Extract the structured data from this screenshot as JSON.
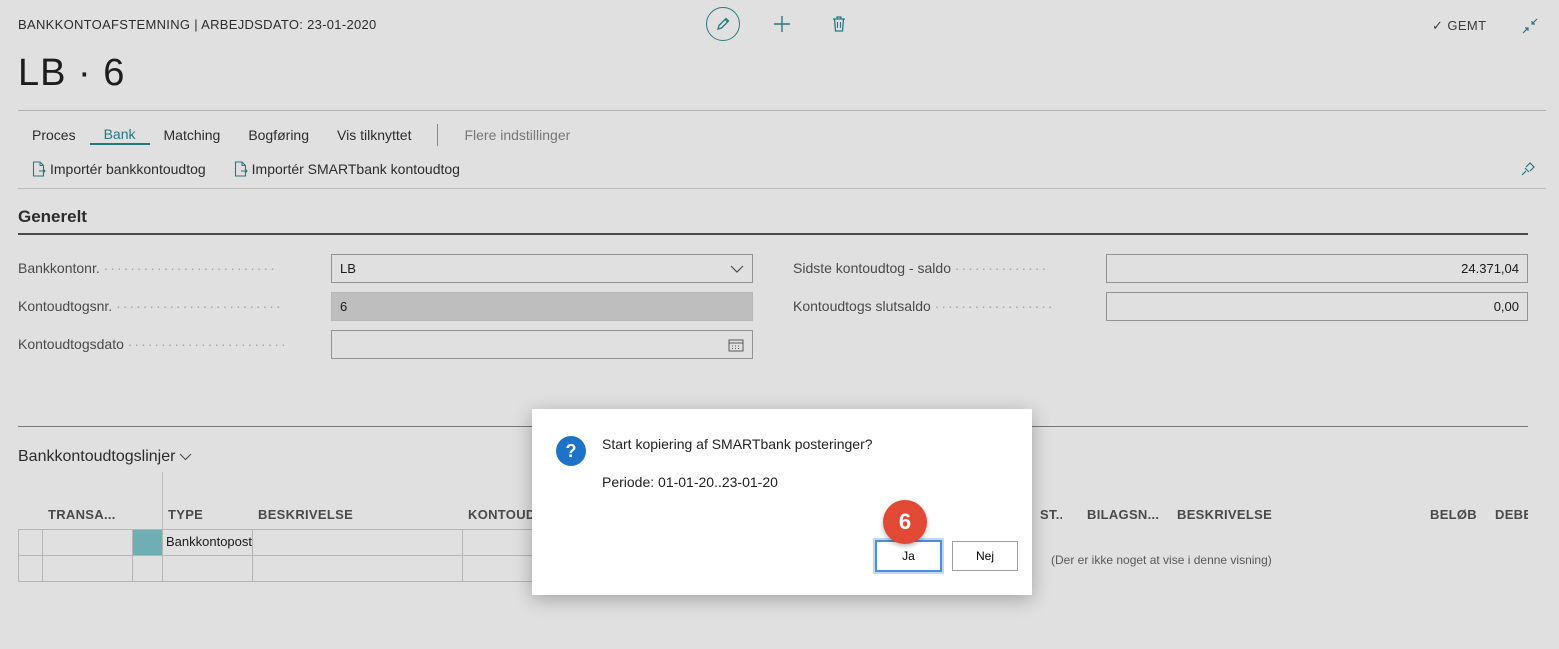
{
  "header": {
    "caption": "BANKKONTOAFSTEMNING | ARBEJDSDATO: 23-01-2020",
    "title": "LB · 6",
    "saved_label": "GEMT"
  },
  "menu": {
    "items": [
      {
        "label": "Proces"
      },
      {
        "label": "Bank",
        "active": true
      },
      {
        "label": "Matching"
      },
      {
        "label": "Bogføring"
      },
      {
        "label": "Vis tilknyttet"
      }
    ],
    "more_label": "Flere indstillinger"
  },
  "actions": {
    "import_bank": "Importér bankkontoudtog",
    "import_smartbank": "Importér SMARTbank kontoudtog"
  },
  "general": {
    "section_title": "Generelt",
    "bank_account_label": "Bankkontonr.",
    "bank_account_value": "LB",
    "statement_no_label": "Kontoudtogsnr.",
    "statement_no_value": "6",
    "statement_date_label": "Kontoudtogsdato",
    "statement_date_value": "",
    "last_balance_label": "Sidste kontoudtog - saldo",
    "last_balance_value": "24.371,04",
    "ending_balance_label": "Kontoudtogs slutsaldo",
    "ending_balance_value": "0,00"
  },
  "lines": {
    "title": "Bankkontoudtogslinjer",
    "columns_left": [
      "TRANSA...",
      "TYPE",
      "BESKRIVELSE",
      "KONTOUDT"
    ],
    "columns_right": [
      "ST...",
      "BILAGSN...",
      "BESKRIVELSE",
      "BELØB",
      "DEBE"
    ],
    "row_type": "Bankkontoposte",
    "empty_message": "(Der er ikke noget at vise i denne visning)"
  },
  "dialog": {
    "question": "Start kopiering af SMARTbank posteringer?",
    "period": "Periode: 01-01-20..23-01-20",
    "yes_label": "Ja",
    "no_label": "Nej",
    "step_badge": "6"
  },
  "colors": {
    "accent": "#2a8a8f",
    "question_icon": "#1e73c7",
    "badge": "#e24a35",
    "focus": "#4a90e2"
  }
}
